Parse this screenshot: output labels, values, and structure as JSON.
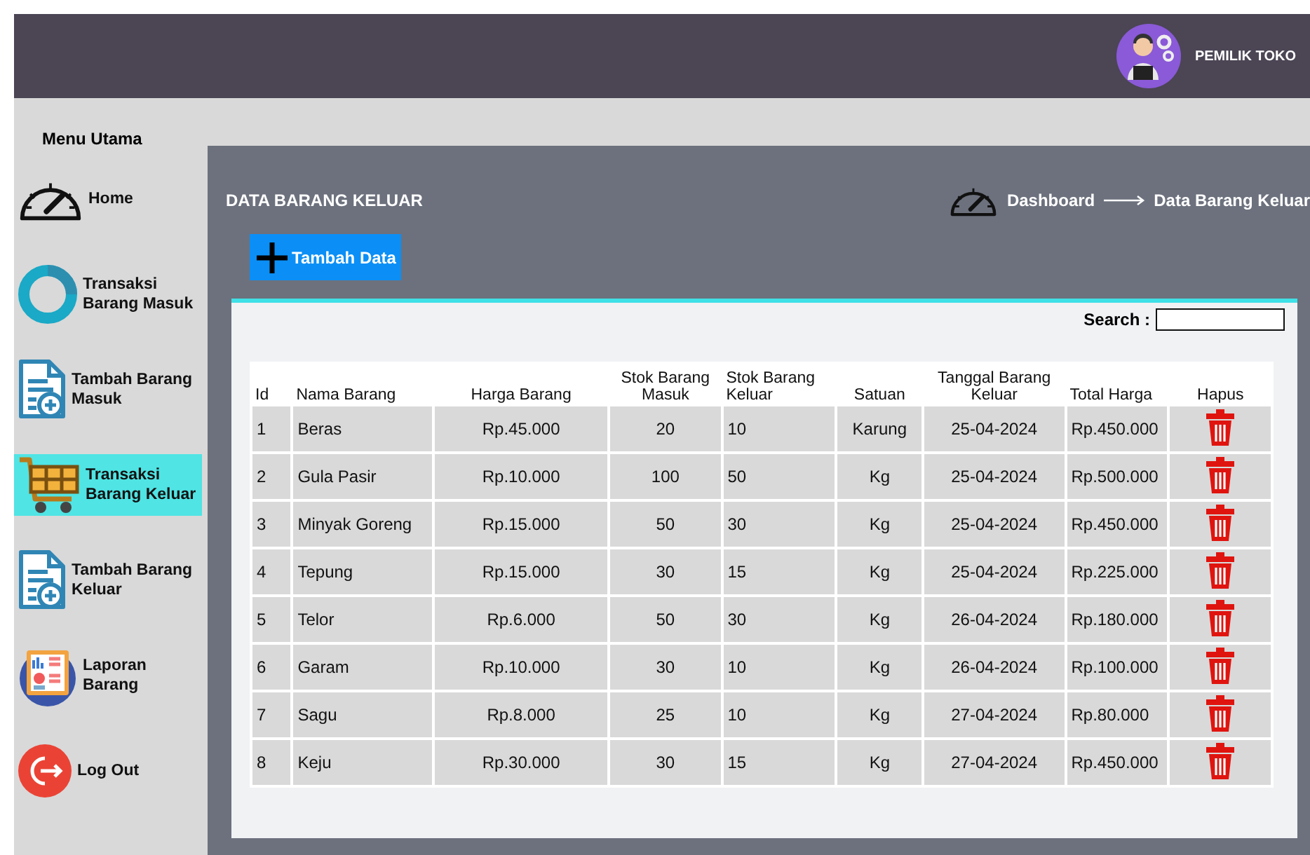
{
  "header": {
    "user": "PEMILIK TOKO"
  },
  "sidebar": {
    "title": "Menu Utama",
    "items": [
      {
        "label": "Home",
        "kind": "gauge",
        "selected": false
      },
      {
        "label": "Transaksi Barang Masuk",
        "kind": "ring",
        "selected": false
      },
      {
        "label": "Tambah Barang Masuk",
        "kind": "doc",
        "selected": false
      },
      {
        "label": "Transaksi Barang Keluar",
        "kind": "cart",
        "selected": true
      },
      {
        "label": "Tambah Barang Keluar",
        "kind": "doc",
        "selected": false
      },
      {
        "label": "Laporan Barang",
        "kind": "report",
        "selected": false
      },
      {
        "label": "Log Out",
        "kind": "logout",
        "selected": false
      }
    ]
  },
  "page": {
    "title": "DATA BARANG KELUAR",
    "breadcrumb": [
      "Dashboard",
      "Data Barang Keluar"
    ],
    "add_button": "Tambah Data"
  },
  "search": {
    "label": "Search :"
  },
  "table": {
    "columns": [
      "Id",
      "Nama Barang",
      "Harga Barang",
      "Stok Barang Masuk",
      "Stok Barang Keluar",
      "Satuan",
      "Tanggal Barang Keluar",
      "Total Harga",
      "Hapus"
    ],
    "rows": [
      [
        "1",
        "Beras",
        "Rp.45.000",
        "20",
        "10",
        "Karung",
        "25-04-2024",
        "Rp.450.000"
      ],
      [
        "2",
        "Gula Pasir",
        "Rp.10.000",
        "100",
        "50",
        "Kg",
        "25-04-2024",
        "Rp.500.000"
      ],
      [
        "3",
        "Minyak Goreng",
        "Rp.15.000",
        "50",
        "30",
        "Kg",
        "25-04-2024",
        "Rp.450.000"
      ],
      [
        "4",
        "Tepung",
        "Rp.15.000",
        "30",
        "15",
        "Kg",
        "25-04-2024",
        "Rp.225.000"
      ],
      [
        "5",
        "Telor",
        "Rp.6.000",
        "50",
        "30",
        "Kg",
        "26-04-2024",
        "Rp.180.000"
      ],
      [
        "6",
        "Garam",
        "Rp.10.000",
        "30",
        "10",
        "Kg",
        "26-04-2024",
        "Rp.100.000"
      ],
      [
        "7",
        "Sagu",
        "Rp.8.000",
        "25",
        "10",
        "Kg",
        "27-04-2024",
        "Rp.80.000"
      ],
      [
        "8",
        "Keju",
        "Rp.30.000",
        "30",
        "15",
        "Kg",
        "27-04-2024",
        "Rp.450.000"
      ]
    ]
  }
}
